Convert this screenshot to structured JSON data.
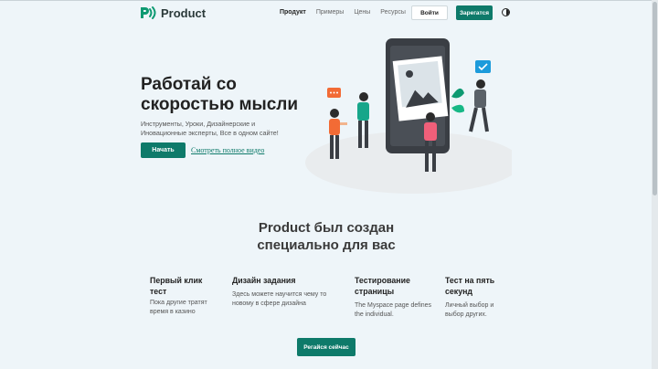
{
  "header": {
    "brand": "Product",
    "nav": [
      "Продукт",
      "Примеры",
      "Цены",
      "Ресурсы"
    ],
    "login_label": "Войти",
    "register_label": "Зарегатся"
  },
  "hero": {
    "title": "Работай со скоростью мысли",
    "subtitle": "Инструменты, Уроки, Дизайнерские и Иновационные эксперты, Все в одном сайте!",
    "start_label": "Начать",
    "video_link": "Смотреть полное видео"
  },
  "section": {
    "title": "Product был создан специально для вас",
    "features": [
      {
        "title": "Первый клик тест",
        "text": "Пока другие тратят время в казино"
      },
      {
        "title": "Дизайн задания",
        "text": "Здесь можете научится чему то новому в сфере дизайна"
      },
      {
        "title": "Тестирование страницы",
        "text": "The Myspace page defines the individual."
      },
      {
        "title": "Тест на пять секунд",
        "text": "Личный выбор и выбор других."
      }
    ],
    "signup_label": "Регайся сейчас"
  },
  "icons": {
    "logo": "brand-logo-icon",
    "theme": "theme-toggle-icon",
    "illustration": "people-with-phones-illustration"
  },
  "colors": {
    "accent": "#0e7a6a",
    "background": "#eef5f9"
  }
}
